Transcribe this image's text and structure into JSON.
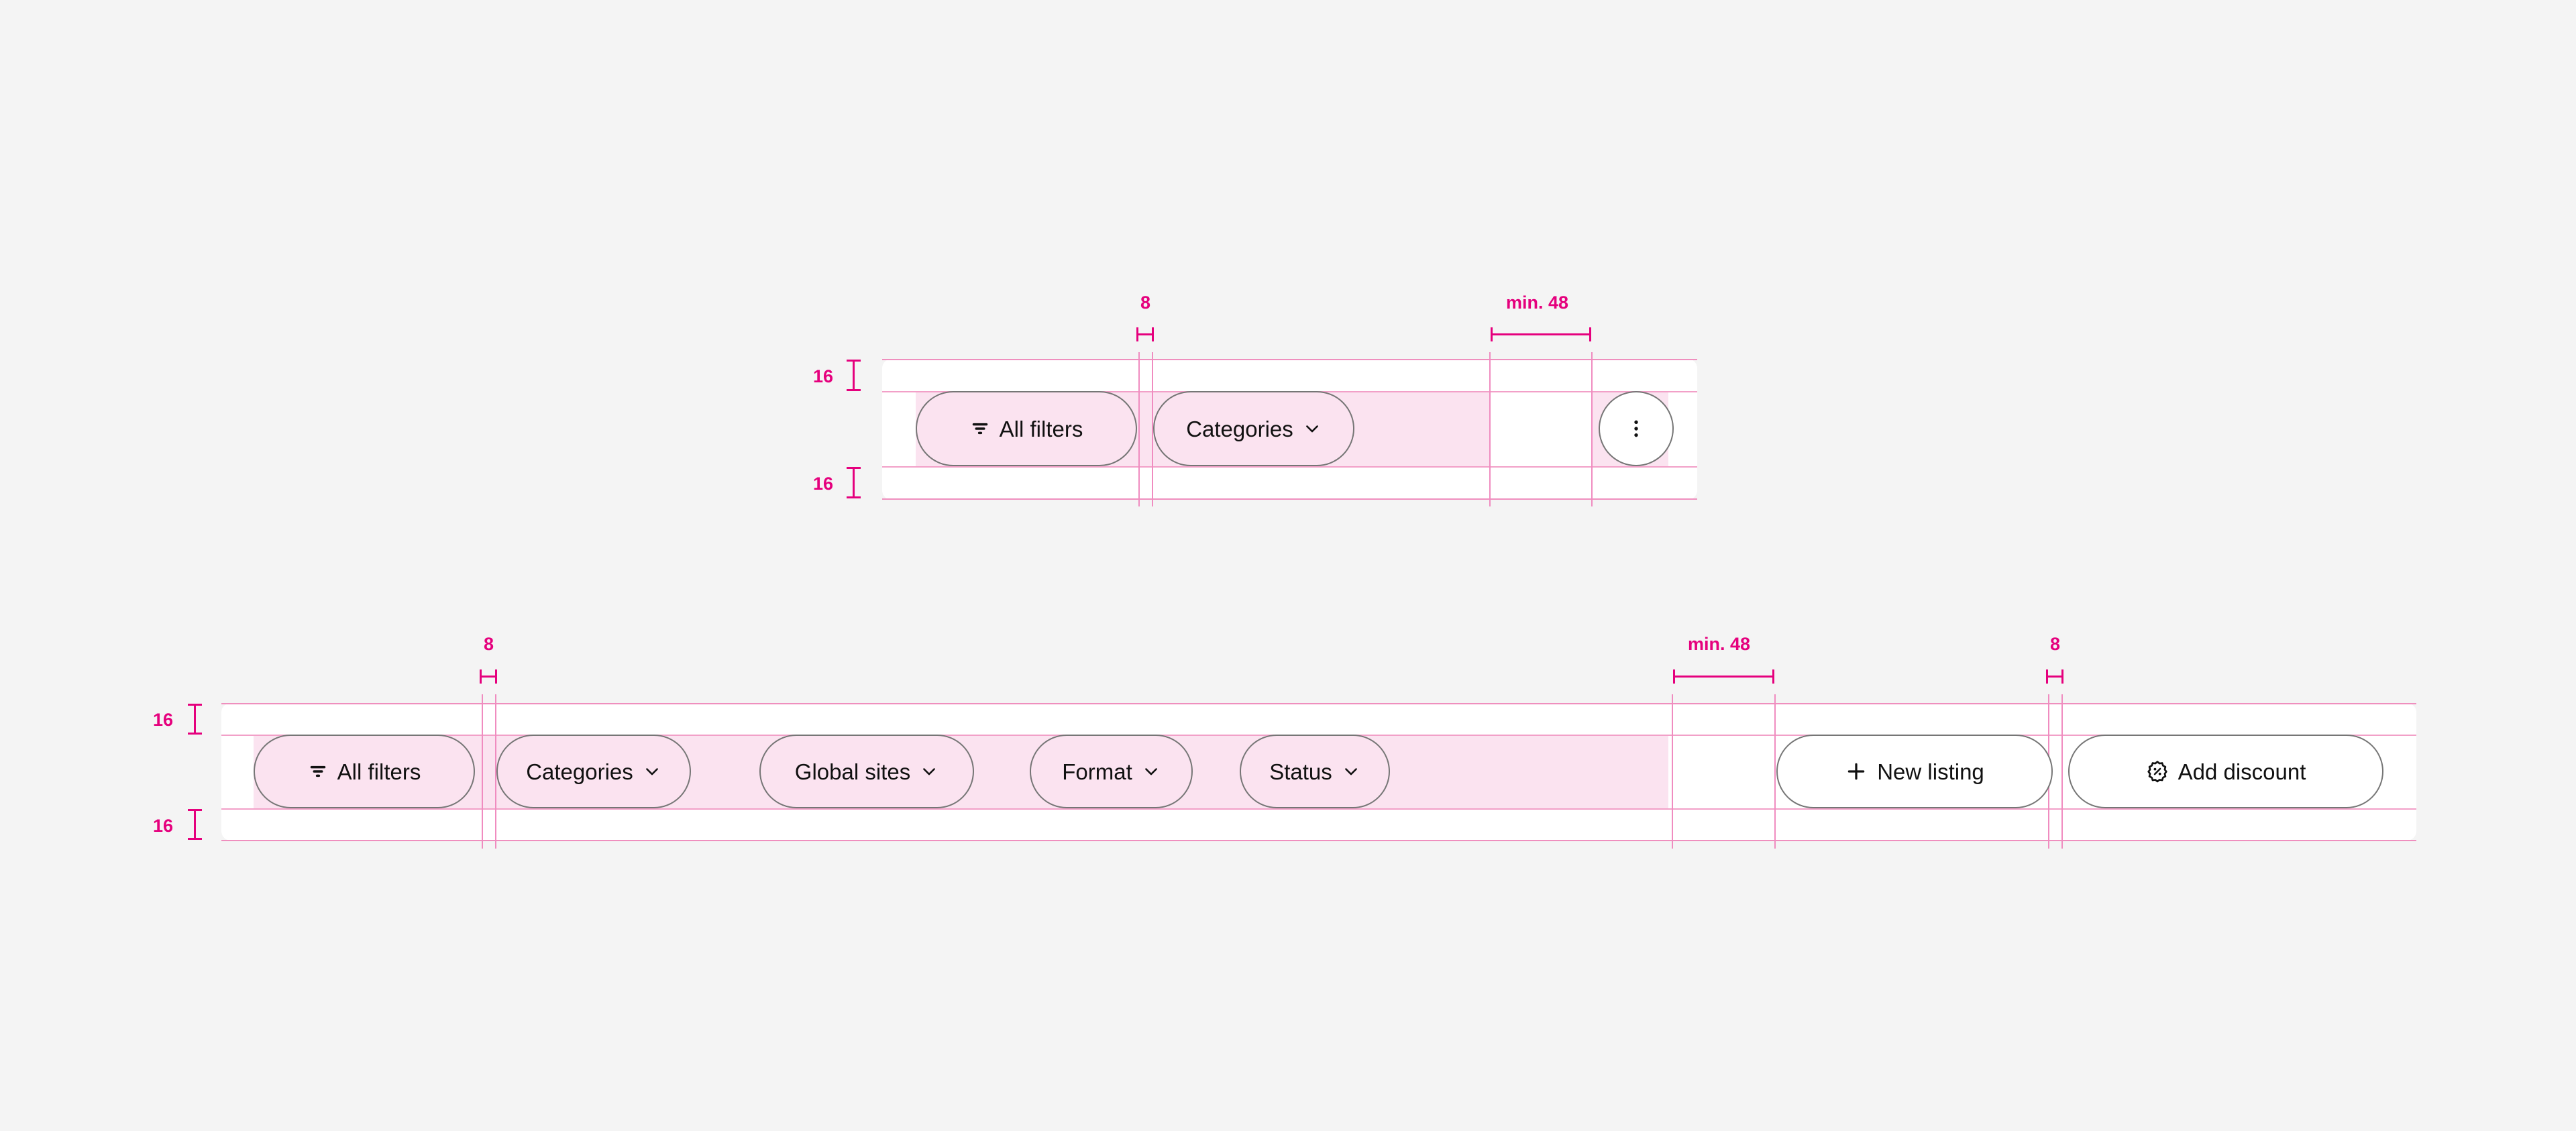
{
  "theme": {
    "page_bg": "#f4f4f4",
    "card_bg": "#ffffff",
    "band_pink": "#fbe3f0",
    "redline_pink": "#f08cc0",
    "annotation_magenta": "#e5007d",
    "pill_border": "#767676",
    "text": "#111111"
  },
  "specimens": [
    {
      "id": "compact-filter-bar",
      "annotations": {
        "gap_between_pills": "8",
        "min_gap_before_actions": "min. 48",
        "padding_top": "16",
        "padding_bottom": "16"
      },
      "filters": [
        {
          "label": "All filters",
          "icon": "filter-icon",
          "has_chevron": false
        },
        {
          "label": "Categories",
          "icon": null,
          "has_chevron": true
        }
      ],
      "actions": [
        {
          "label": "",
          "icon": "more-vertical-icon",
          "shape": "circle"
        }
      ]
    },
    {
      "id": "full-filter-bar",
      "annotations": {
        "gap_between_pills": "8",
        "min_gap_before_actions": "min. 48",
        "gap_between_actions": "8",
        "padding_top": "16",
        "padding_bottom": "16"
      },
      "filters": [
        {
          "label": "All filters",
          "icon": "filter-icon",
          "has_chevron": false
        },
        {
          "label": "Categories",
          "icon": null,
          "has_chevron": true
        },
        {
          "label": "Global sites",
          "icon": null,
          "has_chevron": true
        },
        {
          "label": "Format",
          "icon": null,
          "has_chevron": true
        },
        {
          "label": "Status",
          "icon": null,
          "has_chevron": true
        }
      ],
      "actions": [
        {
          "label": "New listing",
          "icon": "plus-icon",
          "shape": "pill"
        },
        {
          "label": "Add discount",
          "icon": "discount-badge-icon",
          "shape": "pill"
        }
      ]
    }
  ]
}
